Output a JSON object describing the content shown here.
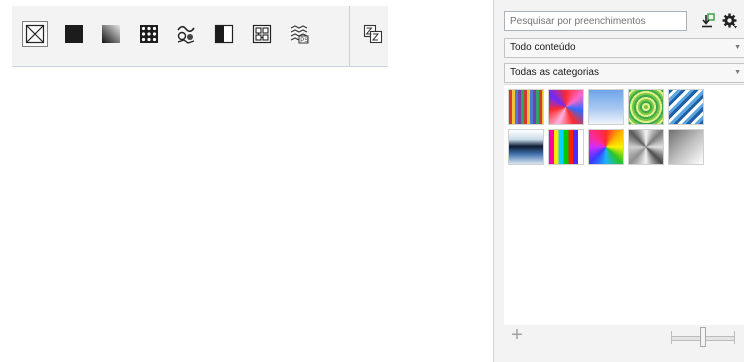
{
  "toolbar": {
    "buttons": [
      {
        "icon": "no-fill-icon",
        "selected": true
      },
      {
        "icon": "uniform-fill-icon"
      },
      {
        "icon": "fountain-fill-icon"
      },
      {
        "icon": "vector-pattern-fill-icon"
      },
      {
        "icon": "bitmap-pattern-fill-icon"
      },
      {
        "icon": "two-color-pattern-fill-icon"
      },
      {
        "icon": "texture-fill-icon"
      },
      {
        "icon": "postscript-fill-icon"
      },
      {
        "icon": "color-merge-icon"
      }
    ]
  },
  "panel": {
    "search_placeholder": "Pesquisar por preenchimentos",
    "content_filter": "Todo conteúdo",
    "category_filter": "Todas as categorias",
    "add_label": "+",
    "swatches": [
      {
        "name": "multicolor-stripes"
      },
      {
        "name": "pink-burst"
      },
      {
        "name": "sky-gradient"
      },
      {
        "name": "green-rings"
      },
      {
        "name": "blue-diagonal-stripes"
      },
      {
        "name": "blue-horizon"
      },
      {
        "name": "rainbow-bars"
      },
      {
        "name": "rainbow-conic"
      },
      {
        "name": "silver-conic"
      },
      {
        "name": "grey-gradient"
      }
    ],
    "zoom_level": 0.5
  },
  "colors": {
    "accent": "#2f9e3f",
    "panel_bg": "#f3f3f3",
    "toolbar_bg": "#f3f3f3"
  }
}
